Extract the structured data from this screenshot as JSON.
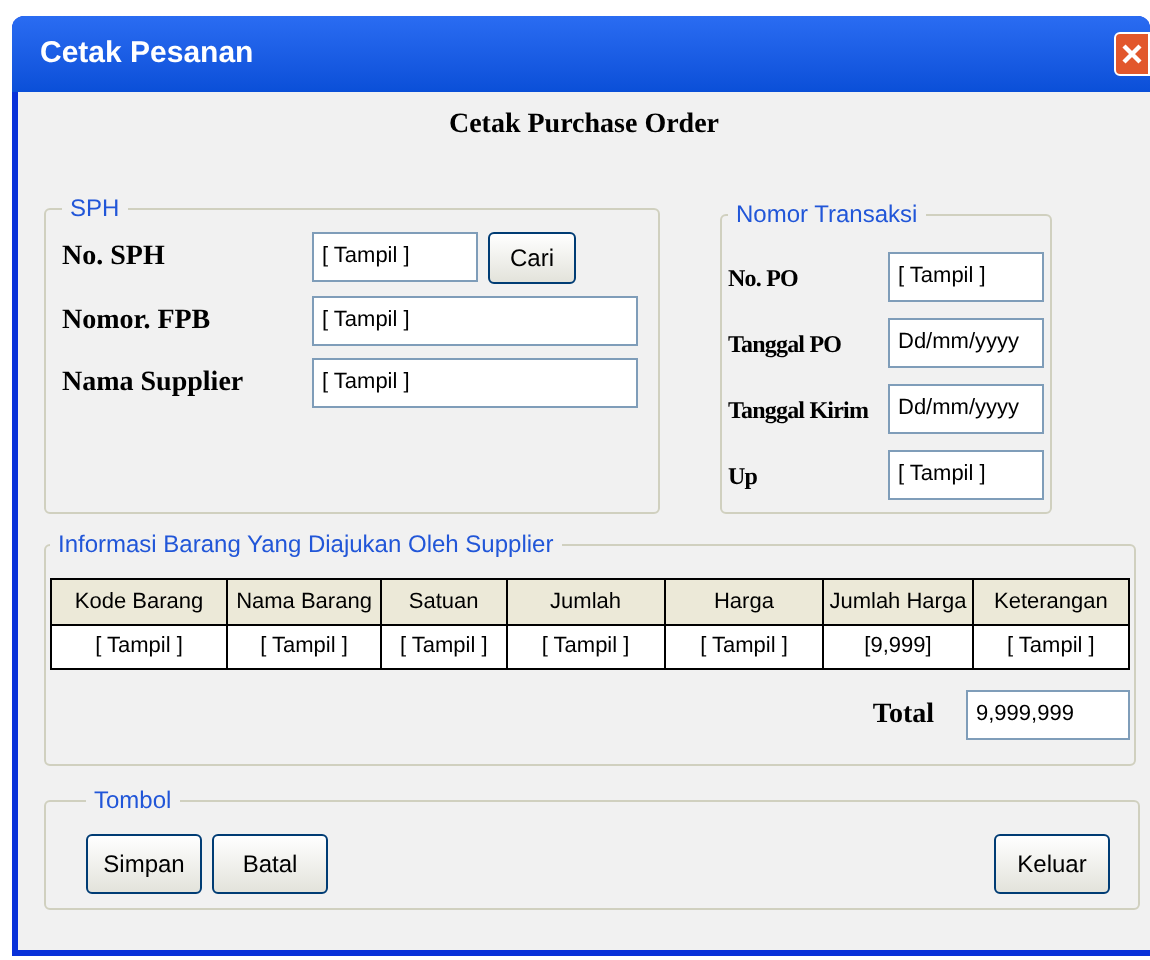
{
  "window": {
    "title": "Cetak Pesanan"
  },
  "heading": "Cetak Purchase Order",
  "sph": {
    "legend": "SPH",
    "fields": [
      {
        "label": "No. SPH",
        "value": "[ Tampil ]",
        "button": "Cari"
      },
      {
        "label": "Nomor. FPB",
        "value": "[ Tampil ]"
      },
      {
        "label": "Nama Supplier",
        "value": "[ Tampil ]"
      }
    ]
  },
  "transaksi": {
    "legend": "Nomor Transaksi",
    "fields": [
      {
        "label": "No. PO",
        "value": "[ Tampil ]"
      },
      {
        "label": "Tanggal PO",
        "value": "Dd/mm/yyyy"
      },
      {
        "label": "Tanggal Kirim",
        "value": "Dd/mm/yyyy"
      },
      {
        "label": "Up",
        "value": "[ Tampil ]"
      }
    ]
  },
  "barang": {
    "legend": "Informasi Barang Yang Diajukan Oleh Supplier",
    "table": {
      "columns": [
        "Kode Barang",
        "Nama Barang",
        "Satuan",
        "Jumlah",
        "Harga",
        "Jumlah Harga",
        "Keterangan"
      ],
      "rows": [
        [
          "[ Tampil ]",
          "[ Tampil ]",
          "[ Tampil ]",
          "[ Tampil ]",
          "[ Tampil ]",
          "[9,999]",
          "[ Tampil ]"
        ]
      ]
    },
    "total_label": "Total",
    "total_value": "9,999,999"
  },
  "tombol": {
    "legend": "Tombol",
    "buttons": [
      "Simpan",
      "Batal",
      "Keluar"
    ]
  }
}
